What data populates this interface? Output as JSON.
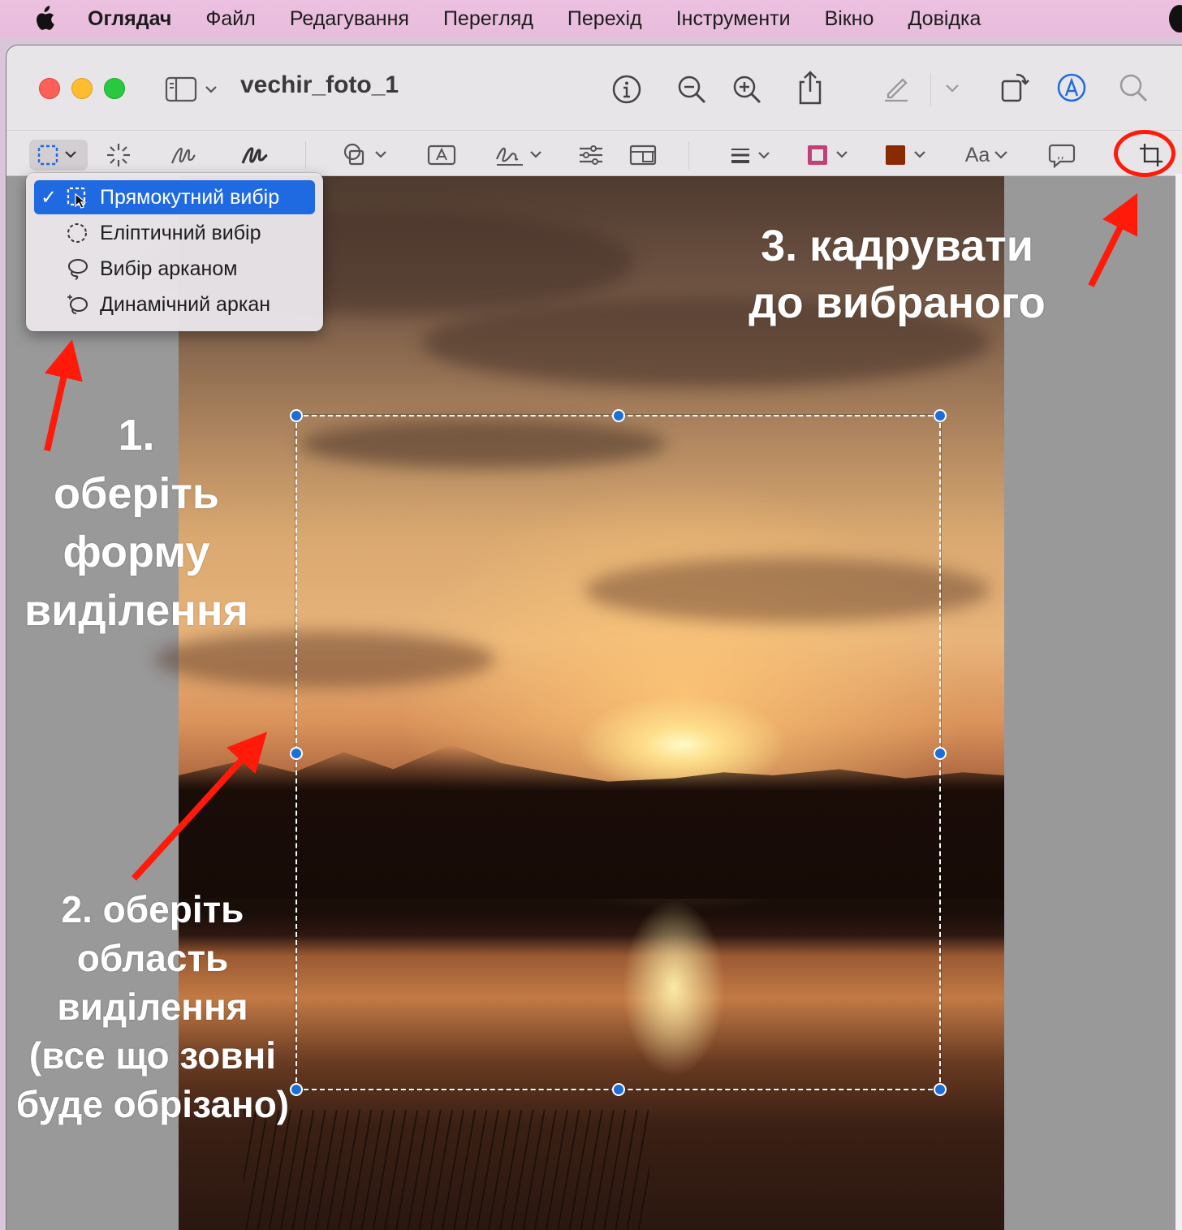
{
  "menubar": {
    "app_name": "Оглядач",
    "items": [
      "Файл",
      "Редагування",
      "Перегляд",
      "Перехід",
      "Інструменти",
      "Вікно",
      "Довідка"
    ]
  },
  "window": {
    "title": "vechir_foto_1"
  },
  "toolbar": {
    "text_style_label": "Aa",
    "colors": {
      "border_color": "#c0407a",
      "fill_color": "#8a2a00",
      "accent": "#1f6ae0"
    }
  },
  "selection_menu": {
    "items": [
      {
        "label": "Прямокутний вибір",
        "checked": true,
        "icon": "rect-selection-icon"
      },
      {
        "label": "Еліптичний вибір",
        "checked": false,
        "icon": "ellipse-selection-icon"
      },
      {
        "label": "Вибір арканом",
        "checked": false,
        "icon": "lasso-icon"
      },
      {
        "label": "Динамічний аркан",
        "checked": false,
        "icon": "smart-lasso-icon"
      }
    ],
    "check_mark": "✓"
  },
  "annotations": {
    "step1": [
      "1.",
      "оберіть",
      "форму",
      "виділення"
    ],
    "step2": [
      "2. оберіть",
      "область",
      "виділення",
      "(все що зовні",
      "буде обрізано)"
    ],
    "step3": [
      "3. кадрувати",
      "до вибраного"
    ],
    "arrow_color": "#ff1a0a"
  }
}
